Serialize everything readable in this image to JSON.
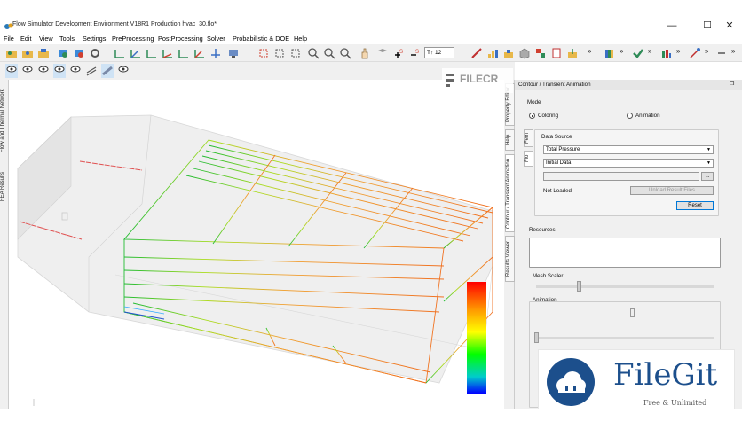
{
  "window": {
    "title": "Flow Simulator Development Environment V18R1 Production hvac_30.flo*",
    "minimize": "—",
    "maximize": "☐",
    "close": "✕"
  },
  "menu": [
    "File",
    "Edit",
    "View",
    "Tools",
    "Settings",
    "PreProcessing",
    "PostProcessing",
    "Solver",
    "Probabilistic & DOE",
    "Help"
  ],
  "toolbar": {
    "text_size_label": "T↑ 12",
    "more": "»"
  },
  "left_tabs": [
    "FEA Results",
    "Flow and Thermal Network"
  ],
  "right_tabs": [
    "Property Editor",
    "Help",
    "Contour / Transient Animation",
    "Results Viewer"
  ],
  "panel": {
    "title": "Contour / Transient Animation",
    "mode_label": "Mode",
    "coloring_label": "Coloring",
    "animation_label": "Animation",
    "inner_tabs": [
      "Flo",
      "Fem"
    ],
    "data_source_label": "Data Source",
    "source_select": "Total Pressure",
    "data_select": "Initial Data",
    "not_loaded": "Not Loaded",
    "unload_button": "Unload Result Files",
    "browse_button": "...",
    "reset_button": "Reset",
    "resources_label": "Resources",
    "mesh_scaler_label": "Mesh Scaler",
    "animation_group_label": "Animation"
  },
  "watermark": {
    "top_text": "FILECR",
    "brand": "FileGit",
    "tagline": "Free & Unlimited"
  },
  "colors": {
    "legend_top": "#ff0000",
    "legend_mid": "#00ff00",
    "legend_bottom": "#0000ff",
    "accent": "#0078d7"
  }
}
